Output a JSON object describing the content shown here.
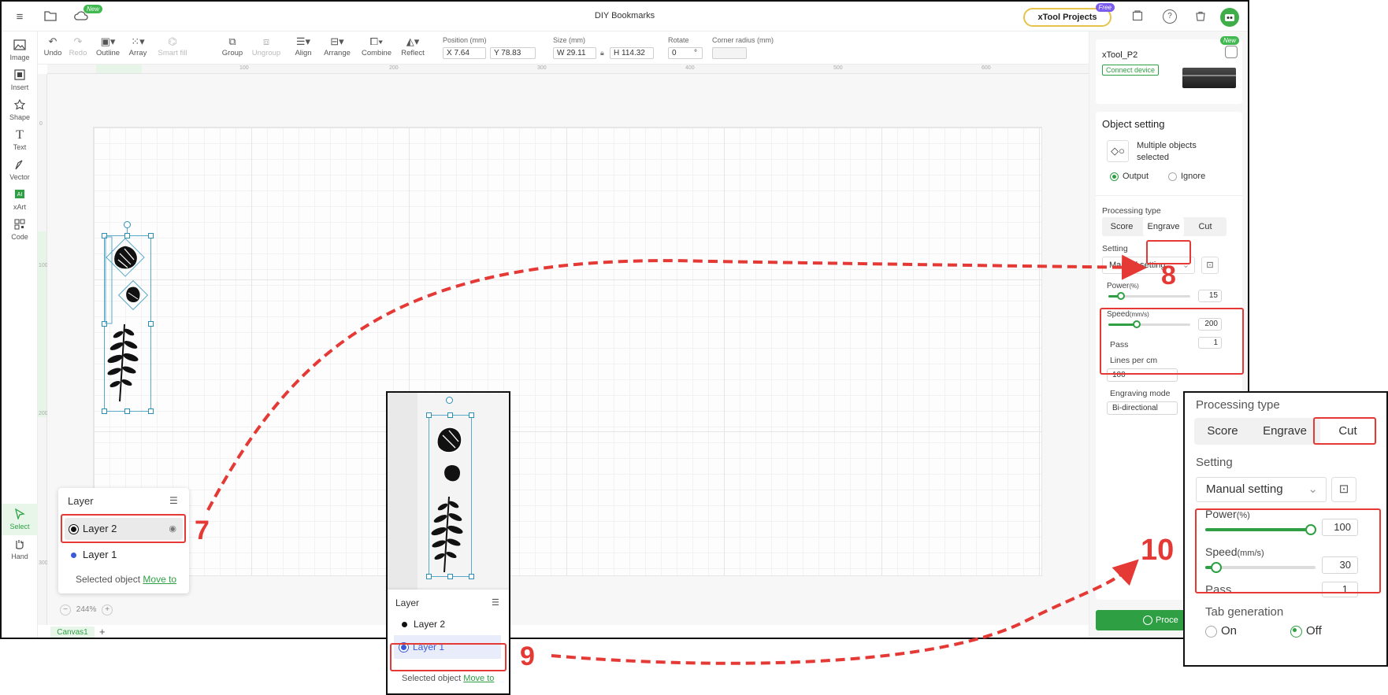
{
  "titlebar": {
    "doc_title": "DIY Bookmarks",
    "projects_label": "xTool Projects",
    "free_badge": "Free",
    "new_badge": "New"
  },
  "left_tools": [
    {
      "label": "Image",
      "icon": "image-icon"
    },
    {
      "label": "Insert",
      "icon": "insert-icon"
    },
    {
      "label": "Shape",
      "icon": "shape-icon"
    },
    {
      "label": "Text",
      "icon": "text-icon"
    },
    {
      "label": "Vector",
      "icon": "vector-pen-icon"
    },
    {
      "label": "xArt",
      "icon": "ai-art-icon"
    },
    {
      "label": "Code",
      "icon": "qr-code-icon"
    },
    {
      "label": "Select",
      "icon": "cursor-icon"
    },
    {
      "label": "Hand",
      "icon": "hand-icon"
    }
  ],
  "toolbar": {
    "undo": "Undo",
    "redo": "Redo",
    "outline": "Outline",
    "array": "Array",
    "smart_fill": "Smart fill",
    "group": "Group",
    "ungroup": "Ungroup",
    "align": "Align",
    "arrange": "Arrange",
    "combine": "Combine",
    "reflect": "Reflect",
    "position_label": "Position (mm)",
    "pos_x": "X 7.64",
    "pos_y": "Y 78.83",
    "size_label": "Size (mm)",
    "size_w": "W 29.11",
    "size_h": "H 114.32",
    "rotate_label": "Rotate",
    "rotate_value": "0",
    "rotate_unit": "°",
    "corner_label": "Corner radius (mm)",
    "corner_value": ""
  },
  "rulers": {
    "top_ticks": [
      "100",
      "200",
      "300",
      "400",
      "500",
      "600"
    ],
    "left_ticks": [
      "0",
      "100",
      "200",
      "300"
    ]
  },
  "layer_panel": {
    "title": "Layer",
    "rows": [
      {
        "name": "Layer 2",
        "color": "#111111"
      },
      {
        "name": "Layer 1",
        "color": "#3a5bd9"
      }
    ],
    "selected_text": "Selected object",
    "move_to": "Move to"
  },
  "zoom": {
    "value": "244%",
    "minus": "−",
    "plus": "+"
  },
  "canvas_tabs": {
    "tab": "Canvas1",
    "add": "+"
  },
  "right_panel": {
    "device_name": "xTool_P2",
    "connect": "Connect device",
    "object_setting": "Object setting",
    "multi_selected": "Multiple objects selected",
    "output": "Output",
    "ignore": "Ignore",
    "processing_type": "Processing type",
    "types": [
      "Score",
      "Engrave",
      "Cut"
    ],
    "selected_type": "Engrave",
    "setting": "Setting",
    "manual_setting": "Manual setting",
    "power_label": "Power",
    "power_unit": "(%)",
    "power_value": "15",
    "power_fraction": 0.15,
    "speed_label": "Speed",
    "speed_unit": "(mm/s)",
    "speed_value": "200",
    "speed_fraction": 0.35,
    "pass_label": "Pass",
    "pass_value": "1",
    "lines_label": "Lines per cm",
    "lines_value": "100",
    "mode_label": "Engraving mode",
    "mode_value": "Bi-directional",
    "process_label": "Proce"
  },
  "inset_cut": {
    "processing_type": "Processing type",
    "types": [
      "Score",
      "Engrave",
      "Cut"
    ],
    "selected_type": "Cut",
    "setting": "Setting",
    "manual_setting": "Manual setting",
    "power_label": "Power",
    "power_unit": "(%)",
    "power_value": "100",
    "power_fraction": 1.0,
    "speed_label": "Speed",
    "speed_unit": "(mm/s)",
    "speed_value": "30",
    "speed_fraction": 0.1,
    "pass_label": "Pass",
    "pass_value": "1",
    "tab_label": "Tab generation",
    "on": "On",
    "off": "Off"
  },
  "inset_layer": {
    "title": "Layer",
    "rows": [
      {
        "name": "Layer 2"
      },
      {
        "name": "Layer 1"
      }
    ],
    "selected_text": "Selected object",
    "move_to": "Move to"
  },
  "callouts": {
    "c7": "7",
    "c8": "8",
    "c9": "9",
    "c10": "10"
  },
  "colors": {
    "accent": "#2ea043",
    "callout": "#e53935",
    "selection": "#5aa9c8"
  }
}
